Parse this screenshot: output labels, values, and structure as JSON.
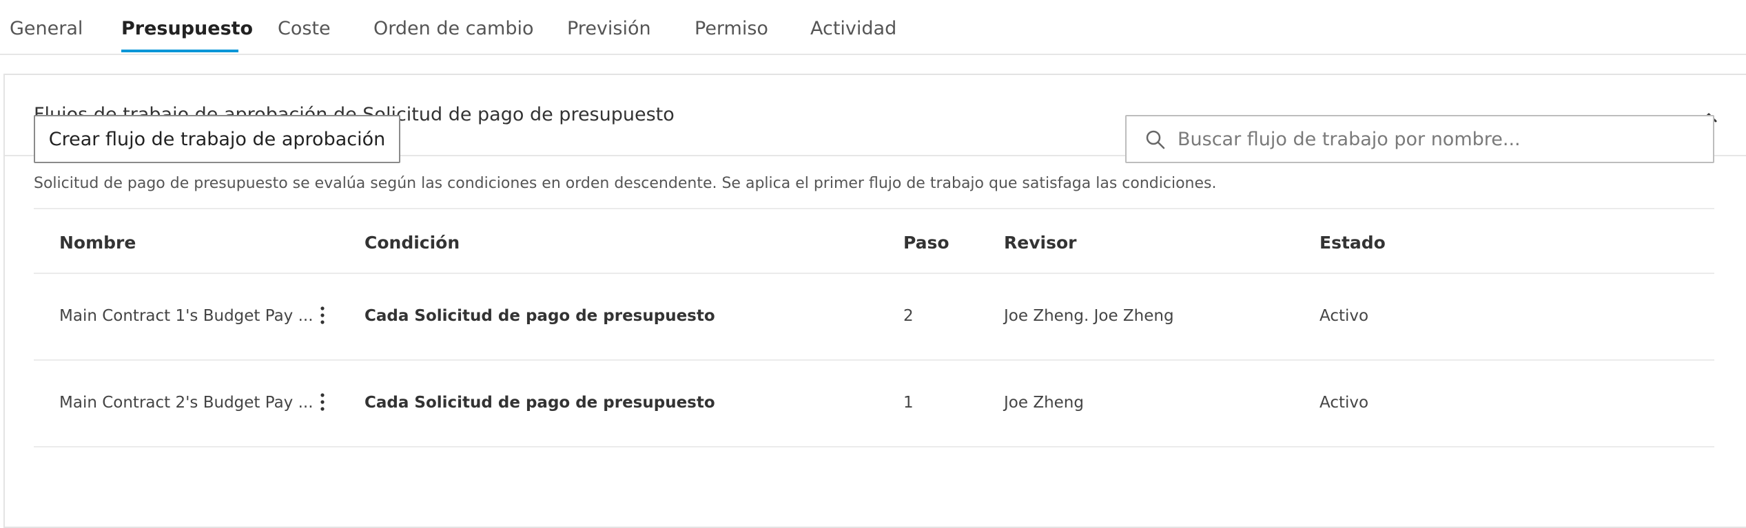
{
  "tabs": [
    {
      "label": "General",
      "active": false
    },
    {
      "label": "Presupuesto",
      "active": true
    },
    {
      "label": "Coste",
      "active": false
    },
    {
      "label": "Orden de cambio",
      "active": false
    },
    {
      "label": "Previsión",
      "active": false
    },
    {
      "label": "Permiso",
      "active": false
    },
    {
      "label": "Actividad",
      "active": false
    }
  ],
  "panel": {
    "title": "Flujos de trabajo de aprobación de Solicitud de pago de presupuesto",
    "collapse_icon": "chevron-up-icon"
  },
  "toolbar": {
    "create_label": "Crear flujo de trabajo de aprobación",
    "search_placeholder": "Buscar flujo de trabajo por nombre...",
    "search_value": "",
    "search_icon": "search-icon"
  },
  "hint": "Solicitud de pago de presupuesto se evalúa según las condiciones en orden descendente. Se aplica el primer flujo de trabajo que satisfaga las condiciones.",
  "table": {
    "columns": [
      "Nombre",
      "Condición",
      "Paso",
      "Revisor",
      "Estado"
    ],
    "rows": [
      {
        "name": "Main Contract 1's Budget Pay ...",
        "condition": "Cada Solicitud de pago de presupuesto",
        "step": "2",
        "reviewer": "Joe Zheng. Joe Zheng",
        "status": "Activo"
      },
      {
        "name": "Main Contract 2's Budget Pay ...",
        "condition": "Cada Solicitud de pago de presupuesto",
        "step": "1",
        "reviewer": "Joe Zheng",
        "status": "Activo"
      }
    ]
  },
  "colors": {
    "accent": "#0696d7",
    "link": "#0a74b4"
  }
}
